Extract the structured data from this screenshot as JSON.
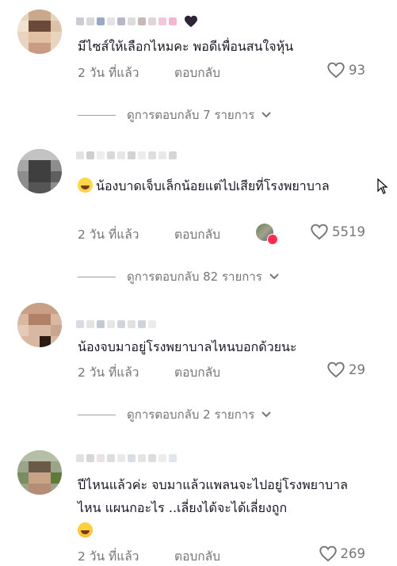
{
  "comments": [
    {
      "text": "มีไซส์ให้เลือกไหมคะ พอดีเพื่อนสนใจหุ้น",
      "date": "2 วัน ที่แล้ว",
      "reply_label": "ตอบกลับ",
      "likes": "93",
      "view_replies": "ดูการตอบกลับ 7 รายการ"
    },
    {
      "emoji": "grinning-sweat-emoji",
      "text": "น้องบาดเจ็บเล็กน้อยแต่ไปเสียที่โรงพยาบาล",
      "date": "2 วัน ที่แล้ว",
      "reply_label": "ตอบกลับ",
      "likes": "5519",
      "view_replies": "ดูการตอบกลับ 82 รายการ"
    },
    {
      "text": "น้องจบมาอยู่โรงพยาบาลไหนบอกด้วยนะ",
      "date": "2 วัน ที่แล้ว",
      "reply_label": "ตอบกลับ",
      "likes": "29",
      "view_replies": "ดูการตอบกลับ 2 รายการ"
    },
    {
      "text": "ปีไหนแล้วค่ะ จบมาแล้วแพลนจะไปอยู่โรงพยาบาลไหน แผนกอะไร ..เลี่ยงได้จะได้เลี่ยงถูก",
      "emoji": "hot-face-emoji",
      "date": "2 วัน ที่แล้ว",
      "reply_label": "ตอบกลับ",
      "likes": "269"
    }
  ],
  "colors": {
    "text": "#161823",
    "muted": "#757575",
    "badge": "#fe2c55"
  }
}
